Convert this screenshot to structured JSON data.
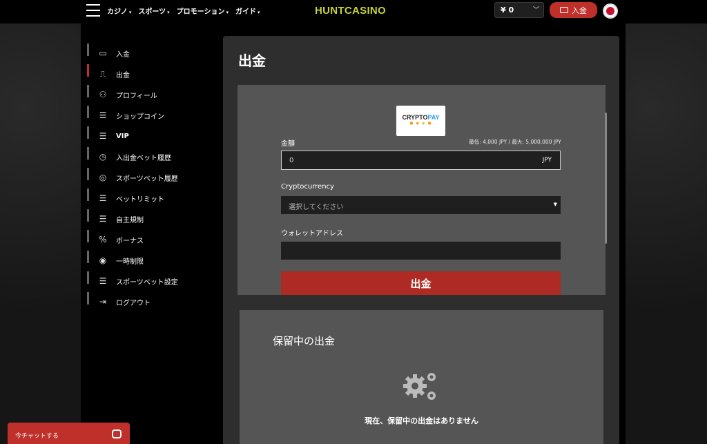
{
  "header": {
    "nav": [
      {
        "label": "カジノ",
        "caret": "▾"
      },
      {
        "label": "スポーツ",
        "caret": "▾"
      },
      {
        "label": "プロモーション",
        "caret": "▾"
      },
      {
        "label": "ガイド",
        "caret": "▾"
      }
    ],
    "logo_part1": "HUNT",
    "logo_part2": "CASINO",
    "balance": "¥ 0",
    "deposit_label": "入金"
  },
  "sidebar": {
    "items": [
      {
        "label": "入金",
        "icon": "cash-icon"
      },
      {
        "label": "出金",
        "icon": "withdraw-icon"
      },
      {
        "label": "プロフィール",
        "icon": "user-icon"
      },
      {
        "label": "ショップコイン",
        "icon": "sliders-icon"
      },
      {
        "label": "VIP",
        "icon": "sliders-icon"
      },
      {
        "label": "入出金ベット履歴",
        "icon": "stopwatch-icon"
      },
      {
        "label": "スポーツベット履歴",
        "icon": "ball-icon"
      },
      {
        "label": "ベットリミット",
        "icon": "sliders-icon"
      },
      {
        "label": "自主規制",
        "icon": "sliders-icon"
      },
      {
        "label": "ボーナス",
        "icon": "percent-icon"
      },
      {
        "label": "一時制限",
        "icon": "eye-icon"
      },
      {
        "label": "スポーツベット設定",
        "icon": "sliders-icon"
      },
      {
        "label": "ログアウト",
        "icon": "logout-icon"
      }
    ],
    "active_index": 1
  },
  "main": {
    "title": "出金",
    "provider_logo_a": "CRYPTO",
    "provider_logo_b": "PAY",
    "amount_label": "金額",
    "limits": "最低: 4,000 JPY / 最大: 5,000,000 JPY",
    "amount_value": "0",
    "amount_unit": "JPY",
    "crypto_label": "Cryptocurrency",
    "crypto_placeholder": "選択してください",
    "wallet_label": "ウォレットアドレス",
    "wallet_value": "",
    "submit_label": "出金"
  },
  "pending": {
    "title": "保留中の出金",
    "empty_message": "現在、保留中の出金はありません"
  },
  "chat": {
    "label": "今チャットする"
  }
}
